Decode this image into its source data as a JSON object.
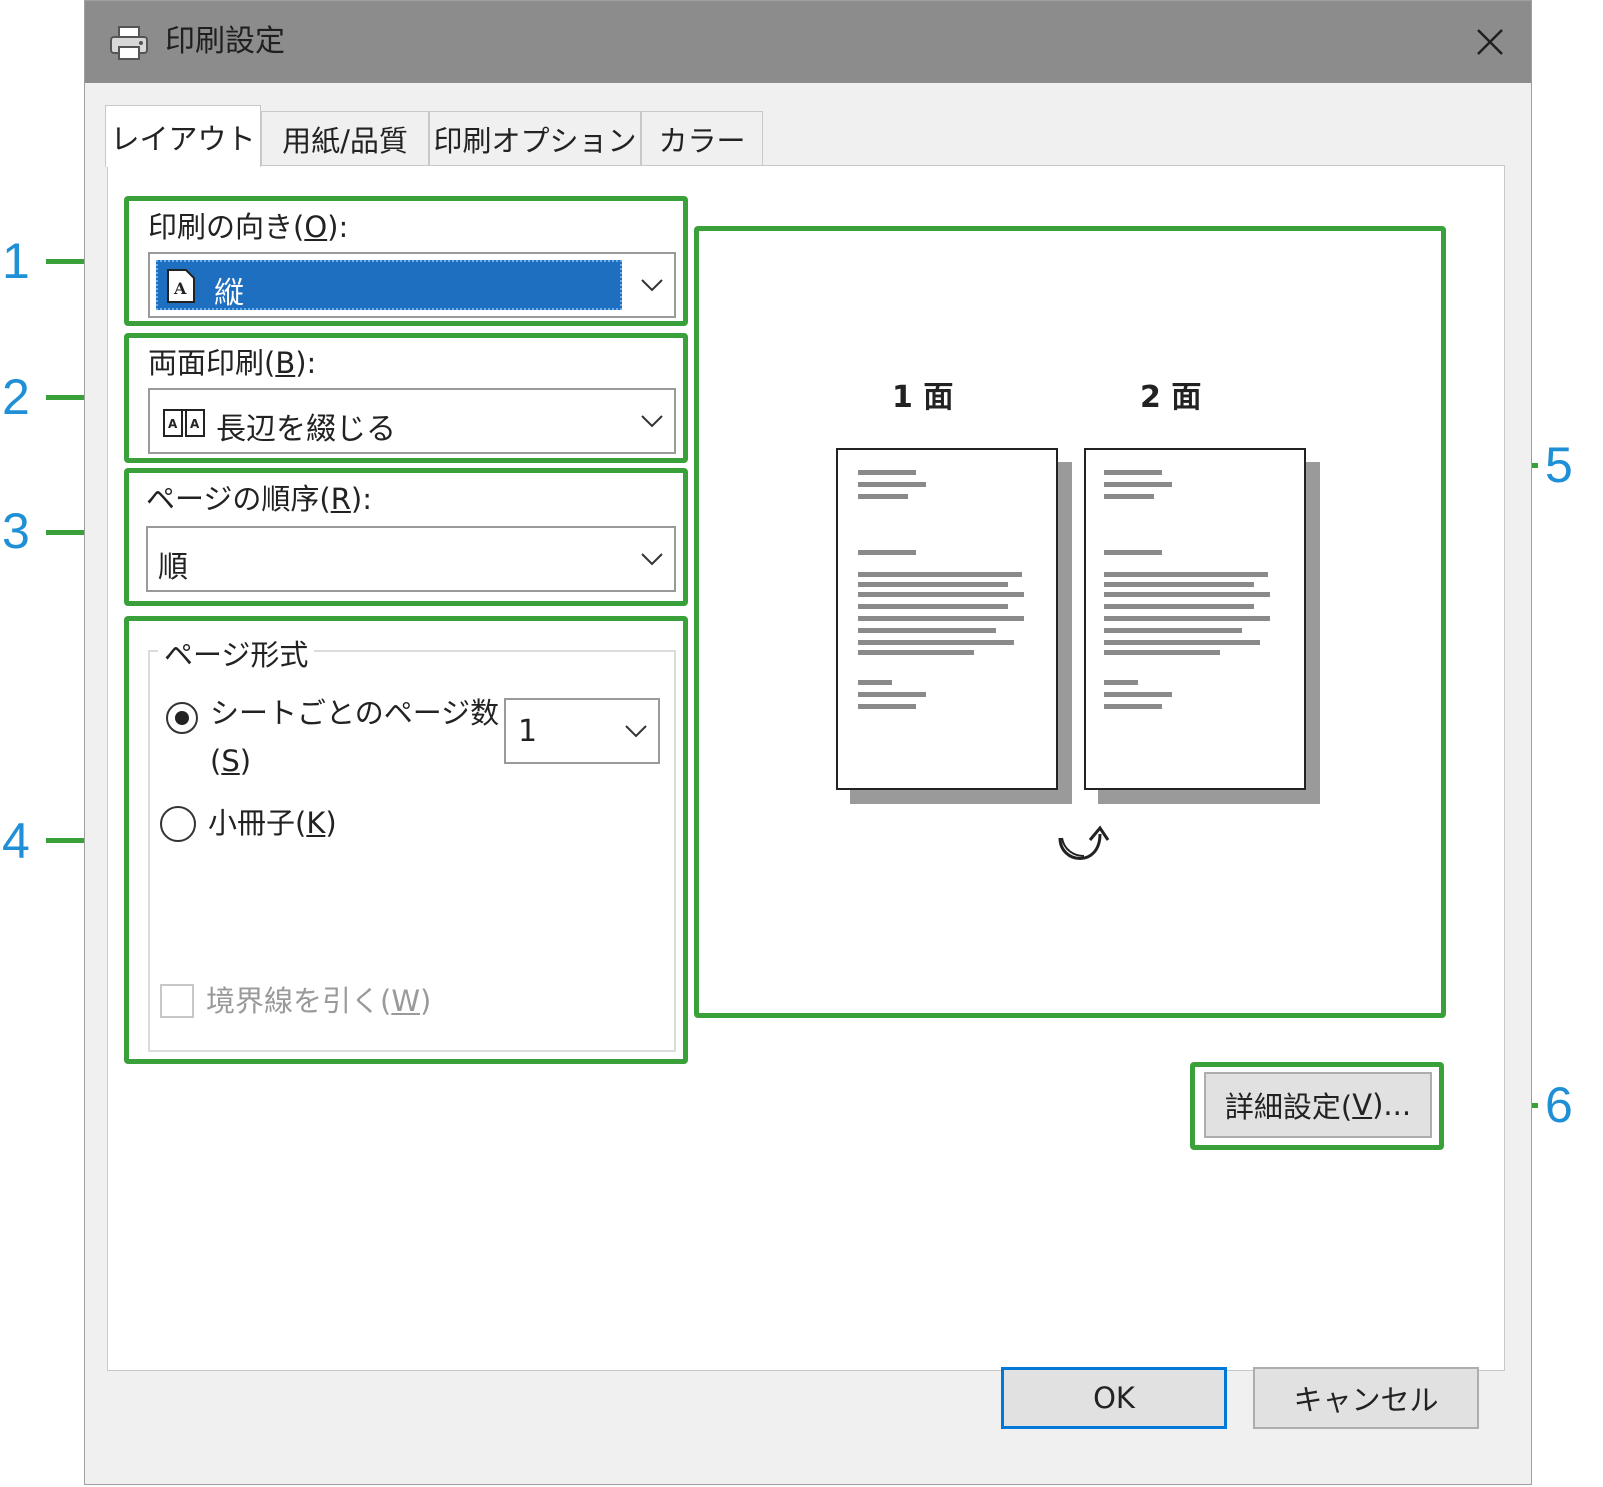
{
  "window": {
    "title": "印刷設定",
    "close_label": "✕"
  },
  "tabs": [
    {
      "label": "レイアウト",
      "active": true
    },
    {
      "label": "用紙/品質",
      "active": false
    },
    {
      "label": "印刷オプション",
      "active": false
    },
    {
      "label": "カラー",
      "active": false
    }
  ],
  "orientation": {
    "label_pre": "印刷の向き(",
    "label_key": "O",
    "label_post": "):",
    "value": "縦"
  },
  "duplex": {
    "label_pre": "両面印刷(",
    "label_key": "B",
    "label_post": "):",
    "value": "長辺を綴じる"
  },
  "page_order": {
    "label_pre": "ページの順序(",
    "label_key": "R",
    "label_post": "):",
    "value": "順"
  },
  "page_format": {
    "legend": "ページ形式",
    "pages_per_sheet": {
      "label_line1": "シートごとのページ数",
      "label_pre": "(",
      "label_key": "S",
      "label_post": ")",
      "value": "1",
      "selected": true
    },
    "booklet": {
      "label_pre": "小冊子(",
      "label_key": "K",
      "label_post": ")",
      "selected": false
    },
    "draw_borders": {
      "label_pre": "境界線を引く(",
      "label_key": "W",
      "label_post": ")",
      "checked": false,
      "disabled": true
    }
  },
  "preview": {
    "page1_label": "1 面",
    "page2_label": "2 面"
  },
  "advanced_button": {
    "label_pre": "詳細設定(",
    "label_key": "V",
    "label_post": ")..."
  },
  "footer": {
    "ok_label": "OK",
    "cancel_label": "キャンセル"
  },
  "callouts": [
    "1",
    "2",
    "3",
    "4",
    "5",
    "6"
  ],
  "colors": {
    "annotation_frame": "#3aa13a",
    "callout_number": "#1f8fd6",
    "selection": "#1f6fc0",
    "titlebar": "#8c8c8c"
  }
}
